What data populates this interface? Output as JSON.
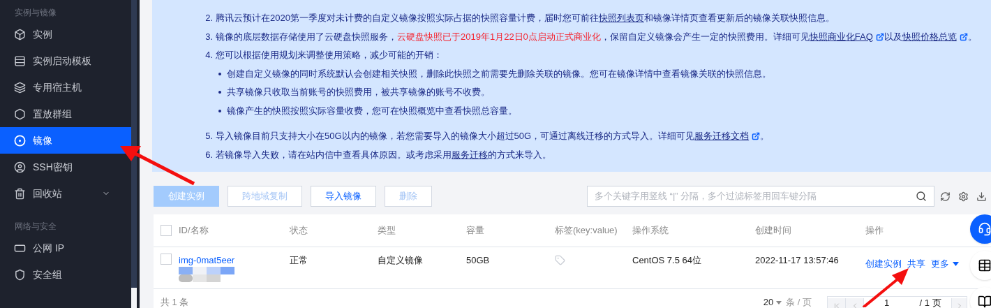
{
  "sidebar": {
    "groups": [
      {
        "title": "实例与镜像",
        "items": [
          {
            "label": "实例",
            "selected": false,
            "expandable": false
          },
          {
            "label": "实例启动模板",
            "selected": false,
            "expandable": false
          },
          {
            "label": "专用宿主机",
            "selected": false,
            "expandable": false
          },
          {
            "label": "置放群组",
            "selected": false,
            "expandable": false
          },
          {
            "label": "镜像",
            "selected": true,
            "expandable": false
          },
          {
            "label": "SSH密钥",
            "selected": false,
            "expandable": false
          },
          {
            "label": "回收站",
            "selected": false,
            "expandable": true
          }
        ]
      },
      {
        "title": "网络与安全",
        "items": [
          {
            "label": "公网 IP",
            "selected": false,
            "expandable": false
          },
          {
            "label": "安全组",
            "selected": false,
            "expandable": false
          }
        ]
      }
    ]
  },
  "notice": {
    "items": [
      {
        "number": "2.",
        "segments": [
          {
            "kind": "text",
            "text": "腾讯云预计在2020第一季度对未计费的自定义镜像按照实际占据的快照容量计费，届时您可前往"
          },
          {
            "kind": "link",
            "text": "快照列表页",
            "external": false
          },
          {
            "kind": "text",
            "text": "和镜像详情页查看更新后的镜像关联快照信息。"
          }
        ]
      },
      {
        "number": "3.",
        "segments": [
          {
            "kind": "text",
            "text": "镜像的底层数据存储使用了云硬盘快照服务，"
          },
          {
            "kind": "alert",
            "text": "云硬盘快照已于2019年1月22日0点启动正式商业化"
          },
          {
            "kind": "text",
            "text": "，保留自定义镜像会产生一定的快照费用。详细可见"
          },
          {
            "kind": "link",
            "text": "快照商业化FAQ",
            "external": true
          },
          {
            "kind": "text",
            "text": "以及"
          },
          {
            "kind": "link",
            "text": "快照价格总览",
            "external": true
          },
          {
            "kind": "text",
            "text": "。"
          }
        ]
      },
      {
        "number": "4.",
        "segments": [
          {
            "kind": "text",
            "text": "您可以根据使用规划来调整使用策略，减少可能的开销："
          }
        ],
        "children": [
          "创建自定义镜像的同时系统默认会创建相关快照，删除此快照之前需要先删除关联的镜像。您可在镜像详情中查看镜像关联的快照信息。",
          "共享镜像只收取当前账号的快照费用，被共享镜像的账号不收费。",
          "镜像产生的快照按照实际容量收费，您可在快照概览中查看快照总容量。"
        ]
      },
      {
        "number": "5.",
        "segments": [
          {
            "kind": "text",
            "text": "导入镜像目前只支持大小在50G以内的镜像，若您需要导入的镜像大小超过50G，可通过离线迁移的方式导入。详细可见"
          },
          {
            "kind": "link",
            "text": "服务迁移文档",
            "external": true
          },
          {
            "kind": "text",
            "text": "。"
          }
        ]
      },
      {
        "number": "6.",
        "segments": [
          {
            "kind": "text",
            "text": "若镜像导入失败，请在站内信中查看具体原因。或考虑采用"
          },
          {
            "kind": "link",
            "text": "服务迁移",
            "external": false
          },
          {
            "kind": "text",
            "text": "的方式来导入。"
          }
        ]
      }
    ]
  },
  "toolbar": {
    "buttons": [
      {
        "label": "创建实例",
        "kind": "primary",
        "disabled": true
      },
      {
        "label": "跨地域复制",
        "kind": "secondary",
        "disabled": true
      },
      {
        "label": "导入镜像",
        "kind": "secondary",
        "disabled": false
      },
      {
        "label": "删除",
        "kind": "secondary",
        "disabled": true
      }
    ],
    "search": {
      "placeholder": "多个关键字用竖线 “|” 分隔，多个过滤标签用回车键分隔"
    }
  },
  "table": {
    "all_checked": false,
    "columns": [
      "ID/名称",
      "状态",
      "类型",
      "容量",
      "标签(key:value)",
      "操作系统",
      "创建时间",
      "操作"
    ],
    "rows": [
      {
        "checked": false,
        "id": "img-0mat5eer",
        "status": "正常",
        "type": "自定义镜像",
        "capacity": "50GB",
        "os": "CentOS 7.5 64位",
        "created": "2022-11-17 13:57:46",
        "actions": [
          {
            "label": "创建实例",
            "dropdown": false
          },
          {
            "label": "共享",
            "dropdown": false
          },
          {
            "label": "更多",
            "dropdown": true
          }
        ]
      }
    ],
    "total": "共 1 条",
    "page_size": "20",
    "page_size_unit": "条 / 页",
    "page": "1",
    "page_count": "/ 1 页"
  }
}
